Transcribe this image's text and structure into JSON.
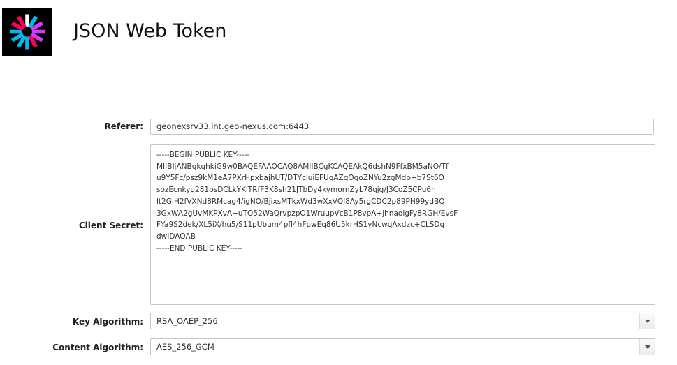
{
  "header": {
    "logo_icon": "jwt-logo-icon",
    "title": "JSON Web Token"
  },
  "form": {
    "referer": {
      "label": "Referer:",
      "value": "geonexsrv33.int.geo-nexus.com:6443"
    },
    "client_secret": {
      "label": "Client Secret:",
      "lines": [
        "-----BEGIN PUBLIC KEY-----",
        "MIIBIjANBgkqhkiG9w0BAQEFAAOCAQ8AMIIBCgKCAQEAkQ6dshN9FfxBM5aNO/Tf",
        "u9Y5Fc/psz9kM1eA7PXrHpxbajhUT/DTYcluiEFUqAZqOgoZNYu2zgMdp+b7St6O",
        "sozEcnkyu281bsDCLkYKlTRfF3K8sh21JTbDy4kymornZyL78qjg/J3CoZ5CPu6h",
        "lt2GIH2fVXNd8RMcag4/igNO/BjixsMTkxWd3wXxVQI8Ay5rgCDC2p89PH99ydBQ",
        "3GxWA2gUvMKPXvA+uTO52WaQrvpzpO1WruupVcB1P8vpA+jhnaolgFy8RGH/EvsF",
        "FYa9S2dek/XL5iX/hu5/S11pUbum4pfl4hFpwEq86U5krHS1yNcwqAxdzc+CLSDg",
        "dwIDAQAB",
        "-----END PUBLIC KEY-----"
      ]
    },
    "key_algorithm": {
      "label": "Key Algorithm:",
      "value": "RSA_OAEP_256",
      "icon": "chevron-down-icon"
    },
    "content_algorithm": {
      "label": "Content Algorithm:",
      "value": "AES_256_GCM",
      "icon": "chevron-down-icon"
    }
  },
  "colors": {
    "logo_background": "#000000",
    "logo_pink": "#fb015b",
    "logo_purple": "#d63aff",
    "logo_cyan": "#00b9f1",
    "field_border": "#c6c6c6"
  }
}
